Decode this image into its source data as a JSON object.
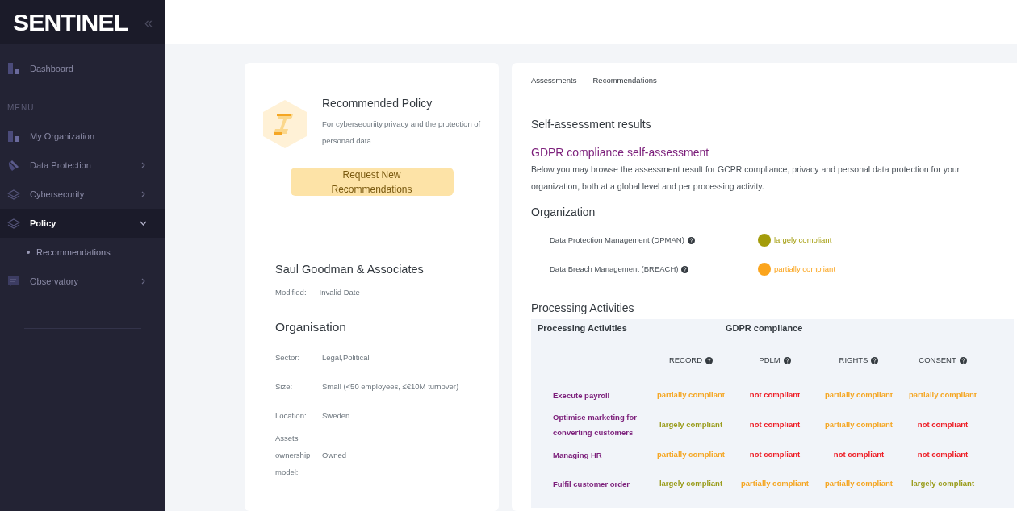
{
  "sidebar": {
    "logo": "SENTINEL",
    "collapse_icon": "«",
    "section_label": "MENU",
    "items": [
      {
        "label": "Dashboard",
        "kind": "link",
        "selected": false
      },
      {
        "label": "My Organization",
        "kind": "link",
        "selected": false
      },
      {
        "label": "Data Protection",
        "kind": "group",
        "expanded": false,
        "selected": false
      },
      {
        "label": "Cybersecurity",
        "kind": "group",
        "expanded": false,
        "selected": false
      },
      {
        "label": "Policy",
        "kind": "group",
        "expanded": true,
        "selected": true,
        "children": [
          {
            "label": "Recommendations"
          }
        ]
      },
      {
        "label": "Observatory",
        "kind": "group",
        "expanded": false,
        "selected": false
      }
    ]
  },
  "policy_card": {
    "title": "Recommended Policy",
    "description": "For cybersecuriity,privacy and the protection of personad data.",
    "button": "Request New Recommendations"
  },
  "organization_card": {
    "name": "Saul Goodman & Associates",
    "modified_label": "Modified:",
    "modified_value": "Invalid Date",
    "section_title": "Organisation",
    "fields": [
      {
        "label": "Sector:",
        "value": "Legal,Political"
      },
      {
        "label": "Size:",
        "value": "Small (<50 employees, ≤€10M turnover)"
      },
      {
        "label": "Location:",
        "value": "Sweden"
      },
      {
        "label": "Assets ownership model:",
        "value": "Owned"
      }
    ]
  },
  "tabs": [
    {
      "label": "Assessments",
      "selected": true
    },
    {
      "label": "Recommendations",
      "selected": false
    }
  ],
  "results": {
    "title": "Self-assessment results",
    "subtitle": "GDPR compliance self-assessment",
    "description": "Below you may browse the assessment result for GCPR compliance, privacy and personal data protection for your organization, both at a global level and per processing activity.",
    "organization_title": "Organization",
    "organization_items": [
      {
        "label": "Data Protection Management (DPMAN)",
        "color": "#a39c0a",
        "result": "largely compliant"
      },
      {
        "label": "Data Breach Management (BREACH)",
        "color": "#fba41c",
        "result": "partially compliant"
      }
    ],
    "activities_title": "Processing Activities",
    "table": {
      "header_left": "Processing Activities",
      "header_group": "GDPR compliance",
      "columns": [
        "RECORD",
        "PDLM",
        "RIGHTS",
        "CONSENT"
      ],
      "rows": [
        {
          "activity": "Execute payroll",
          "cells": [
            {
              "color": "#f5a623",
              "text": "partially compliant"
            },
            {
              "color": "#ee1c24",
              "text": "not compliant"
            },
            {
              "color": "#f5a623",
              "text": "partially compliant"
            },
            {
              "color": "#f5a623",
              "text": "partially compliant"
            }
          ]
        },
        {
          "activity": "Optimise marketing for converting customers",
          "cells": [
            {
              "color": "#9a9c1c",
              "text": "largely compliant"
            },
            {
              "color": "#ee1c24",
              "text": "not compliant"
            },
            {
              "color": "#f5a623",
              "text": "partially compliant"
            },
            {
              "color": "#ee1c24",
              "text": "not compliant"
            }
          ]
        },
        {
          "activity": "Managing HR",
          "cells": [
            {
              "color": "#f5a623",
              "text": "partially compliant"
            },
            {
              "color": "#ee1c24",
              "text": "not compliant"
            },
            {
              "color": "#ee1c24",
              "text": "not compliant"
            },
            {
              "color": "#ee1c24",
              "text": "not compliant"
            }
          ]
        },
        {
          "activity": "Fulfil customer order",
          "cells": [
            {
              "color": "#9a9c1c",
              "text": "largely compliant"
            },
            {
              "color": "#f5a623",
              "text": "partially compliant"
            },
            {
              "color": "#f5a623",
              "text": "partially compliant"
            },
            {
              "color": "#9a9c1c",
              "text": "largely compliant"
            }
          ]
        }
      ]
    }
  }
}
